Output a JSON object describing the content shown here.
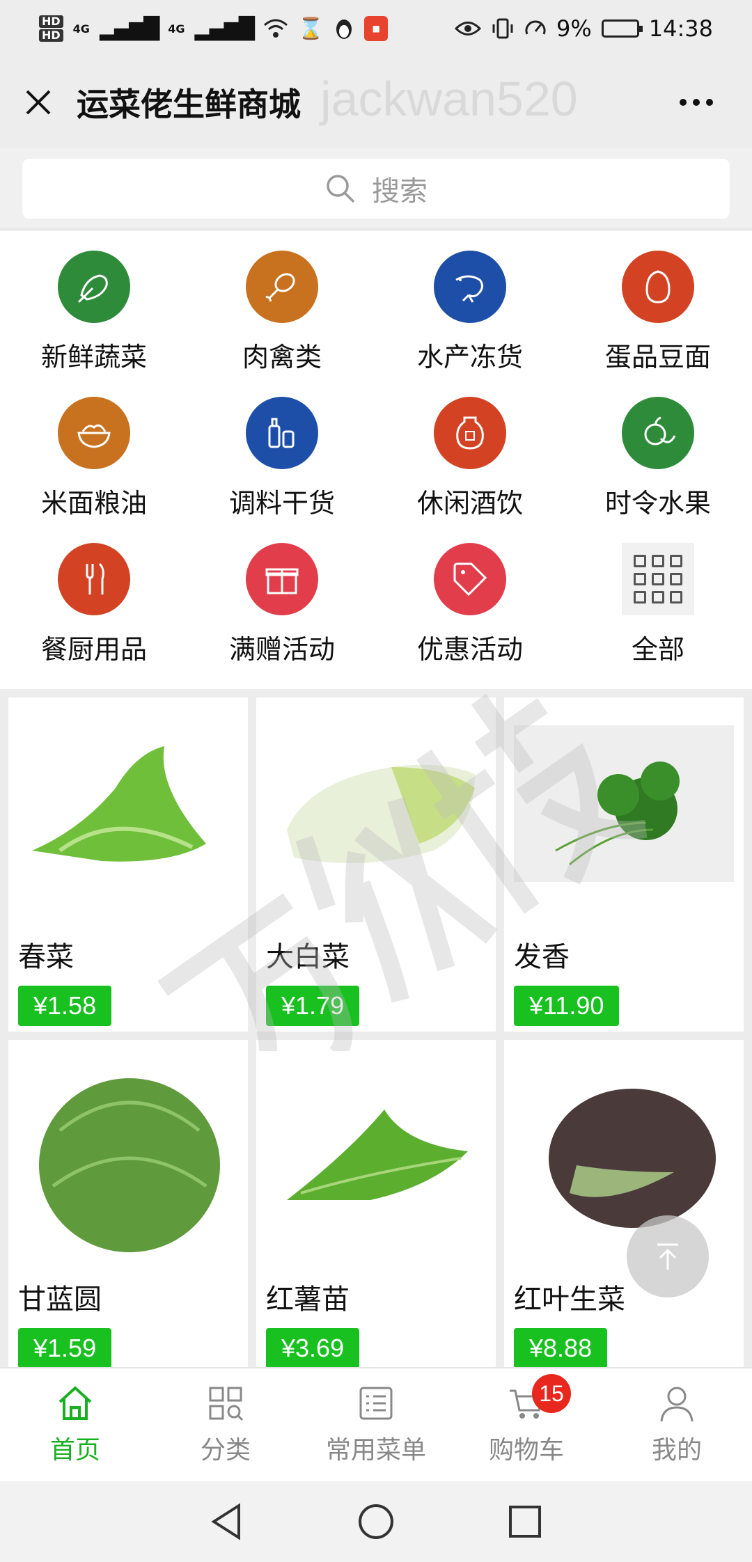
{
  "status_bar": {
    "hd1": "HD",
    "hd2": "HD",
    "network1": "4G",
    "network2": "4G",
    "battery": "9%",
    "time": "14:38"
  },
  "header": {
    "title": "运菜佬生鲜商城",
    "watermark": "jackwan520"
  },
  "search": {
    "placeholder": "搜索"
  },
  "categories": [
    {
      "label": "新鲜蔬菜",
      "icon": "vegetable-icon",
      "color": "#2e8b3a"
    },
    {
      "label": "肉禽类",
      "icon": "meat-icon",
      "color": "#c8711f"
    },
    {
      "label": "水产冻货",
      "icon": "shrimp-icon",
      "color": "#1e4fa8"
    },
    {
      "label": "蛋品豆面",
      "icon": "egg-icon",
      "color": "#d34323"
    },
    {
      "label": "米面粮油",
      "icon": "rice-bowl-icon",
      "color": "#c8711f"
    },
    {
      "label": "调料干货",
      "icon": "seasoning-icon",
      "color": "#1e4fa8"
    },
    {
      "label": "休闲酒饮",
      "icon": "wine-jar-icon",
      "color": "#d34323"
    },
    {
      "label": "时令水果",
      "icon": "fruit-icon",
      "color": "#2e8b3a"
    },
    {
      "label": "餐厨用品",
      "icon": "utensils-icon",
      "color": "#d34323"
    },
    {
      "label": "满赠活动",
      "icon": "gift-icon",
      "color": "#e23d4a"
    },
    {
      "label": "优惠活动",
      "icon": "coupon-tag-icon",
      "color": "#e23d4a"
    },
    {
      "label": "全部",
      "icon": "grid-icon",
      "color": "#f1f1f1"
    }
  ],
  "products": [
    {
      "name": "春菜",
      "price": "¥1.58"
    },
    {
      "name": "大白菜",
      "price": "¥1.79"
    },
    {
      "name": "发香",
      "price": "¥11.90"
    },
    {
      "name": "甘蓝圆",
      "price": "¥1.59"
    },
    {
      "name": "红薯苗",
      "price": "¥3.69"
    },
    {
      "name": "红叶生菜",
      "price": "¥8.88"
    }
  ],
  "tabbar": {
    "items": [
      {
        "label": "首页",
        "active": true
      },
      {
        "label": "分类",
        "active": false
      },
      {
        "label": "常用菜单",
        "active": false
      },
      {
        "label": "购物车",
        "active": false
      },
      {
        "label": "我的",
        "active": false
      }
    ],
    "cart_count": "15",
    "active_color": "#18b020"
  },
  "colors": {
    "price_bg": "#18c020",
    "badge": "#e8281e"
  }
}
